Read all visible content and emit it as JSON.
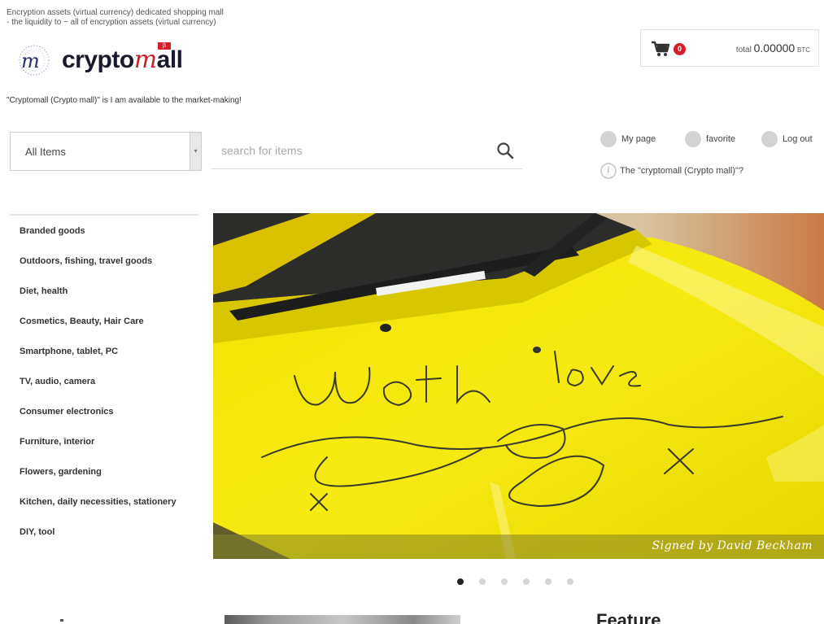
{
  "header": {
    "tagline": [
      "Encryption assets (virtual currency) dedicated shopping mall",
      "- the liquidity to ~ all of encryption assets (virtual currency)"
    ],
    "logo": {
      "text_prefix": "crypto",
      "text_m": "m",
      "text_suffix": "all"
    },
    "slogan": "\"Cryptomall (Crypto mall)\" is I am available to the market-making!"
  },
  "cart": {
    "count": "0",
    "total_label": "total",
    "total_amount": "0.00000",
    "currency": "BTC"
  },
  "search": {
    "category_selected": "All Items",
    "placeholder": "search for items"
  },
  "user_links": {
    "my_page": "My page",
    "favorite": "favorite",
    "logout": "Log out",
    "about": "The \"cryptomall (Crypto mall)\"?"
  },
  "sidebar": {
    "items": [
      "Branded goods",
      "Outdoors, fishing, travel goods",
      "Diet, health",
      "Cosmetics, Beauty, Hair Care",
      "Smartphone, tablet, PC",
      "TV, audio, camera",
      "Consumer electronics",
      "Furniture, interior",
      "Flowers, gardening",
      "Kitchen, daily necessities, stationery",
      "DIY, tool"
    ]
  },
  "banner": {
    "handwriting": "With love",
    "caption": "Signed by David Beckham",
    "colors": {
      "paint": "#f5e400",
      "caption_bar": "#828228"
    }
  },
  "carousel": {
    "slide_count": 6,
    "active_index": 0
  },
  "feature": {
    "heading": "Feature"
  },
  "colors": {
    "accent_red": "#d71e28",
    "text_dark": "#333333",
    "border": "#e2e2e2"
  }
}
